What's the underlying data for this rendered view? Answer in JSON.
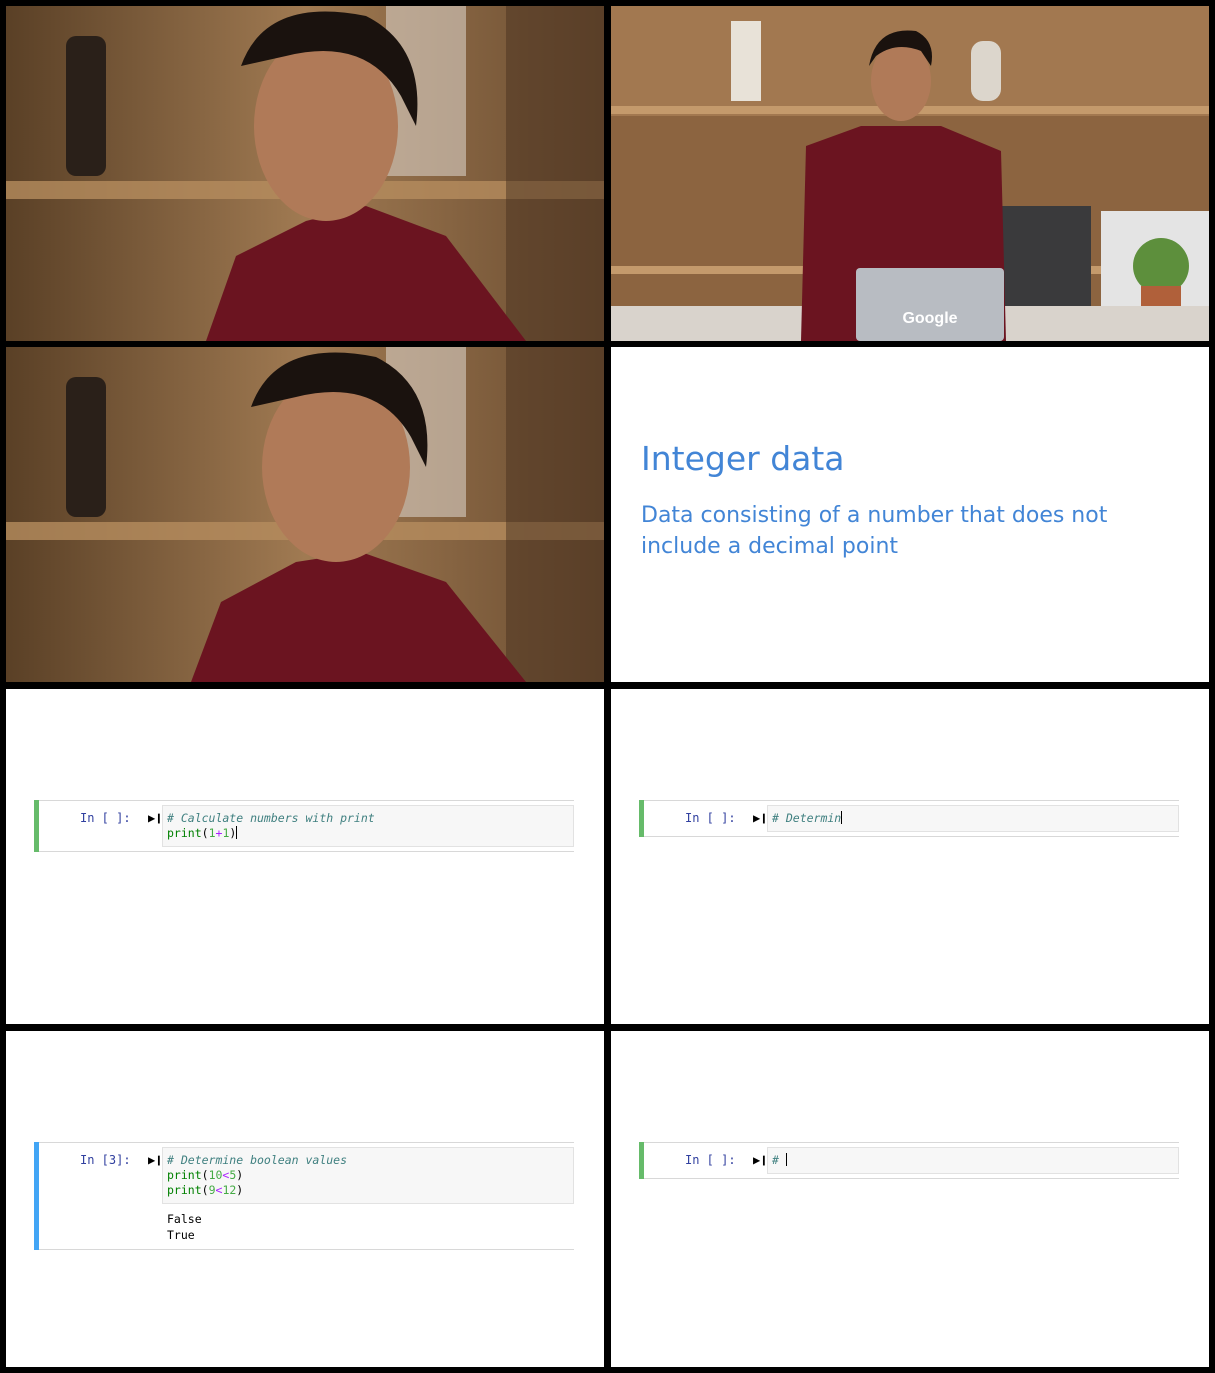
{
  "slide": {
    "title": "Integer data",
    "definition": "Data consisting of a number that does not include a decimal point"
  },
  "laptop": {
    "logo": "Google"
  },
  "cells": [
    {
      "prompt": "In [ ]:",
      "run_icon": "run-cell-icon",
      "lines": [
        [
          {
            "t": "# Calculate numbers with print",
            "c": "comment"
          }
        ],
        [
          {
            "t": "print",
            "c": "builtin"
          },
          {
            "t": "(",
            "c": "text"
          },
          {
            "t": "1",
            "c": "num"
          },
          {
            "t": "+",
            "c": "op"
          },
          {
            "t": "1",
            "c": "num"
          },
          {
            "t": ")",
            "c": "text"
          }
        ]
      ],
      "output": []
    },
    {
      "prompt": "In [ ]:",
      "run_icon": "run-cell-icon",
      "lines": [
        [
          {
            "t": "# Determin",
            "c": "comment"
          }
        ]
      ],
      "output": []
    },
    {
      "prompt": "In [3]:",
      "run_icon": "run-cell-icon",
      "lines": [
        [
          {
            "t": "# Determine boolean values",
            "c": "comment"
          }
        ],
        [
          {
            "t": "print",
            "c": "builtin"
          },
          {
            "t": "(",
            "c": "text"
          },
          {
            "t": "10",
            "c": "num"
          },
          {
            "t": "<",
            "c": "op"
          },
          {
            "t": "5",
            "c": "num"
          },
          {
            "t": ")",
            "c": "text"
          }
        ],
        [
          {
            "t": "print",
            "c": "builtin"
          },
          {
            "t": "(",
            "c": "text"
          },
          {
            "t": "9",
            "c": "num"
          },
          {
            "t": "<",
            "c": "op"
          },
          {
            "t": "12",
            "c": "num"
          },
          {
            "t": ")",
            "c": "text"
          }
        ]
      ],
      "output": [
        "False",
        "True"
      ]
    },
    {
      "prompt": "In [ ]:",
      "run_icon": "run-cell-icon",
      "lines": [
        [
          {
            "t": "# ",
            "c": "comment"
          }
        ]
      ],
      "output": []
    }
  ]
}
